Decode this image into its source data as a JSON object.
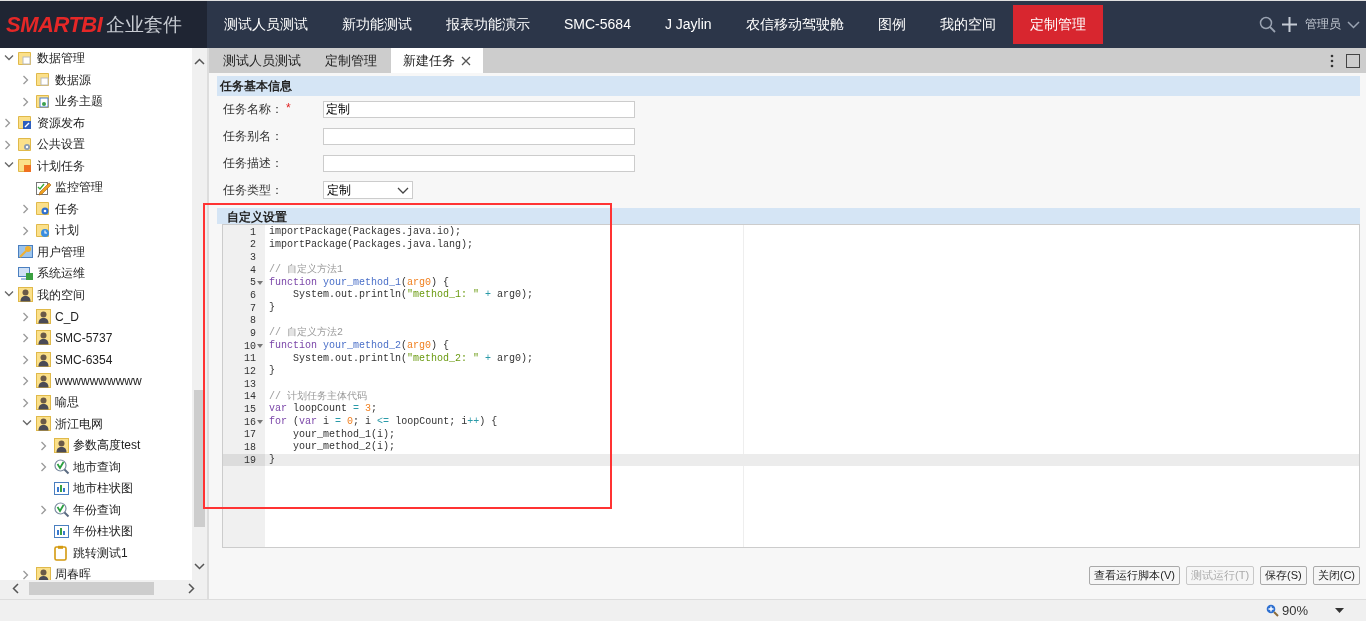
{
  "header": {
    "logo_brand": "SMARTBI",
    "logo_suffix": "企业套件",
    "nav": [
      {
        "label": "测试人员测试",
        "selected": false
      },
      {
        "label": "新功能测试",
        "selected": false
      },
      {
        "label": "报表功能演示",
        "selected": false
      },
      {
        "label": "SMC-5684",
        "selected": false
      },
      {
        "label": "J Jaylin",
        "selected": false
      },
      {
        "label": "农信移动驾驶舱",
        "selected": false
      },
      {
        "label": "图例",
        "selected": false
      },
      {
        "label": "我的空间",
        "selected": false
      },
      {
        "label": "定制管理",
        "selected": true
      }
    ],
    "user": "管理员"
  },
  "sidebar": {
    "items": [
      {
        "label": "数据管理",
        "kind": "folder",
        "expanded": true,
        "children": [
          {
            "label": "数据源",
            "kind": "folder",
            "expanded": false
          },
          {
            "label": "业务主题",
            "kind": "topic",
            "expanded": false
          }
        ]
      },
      {
        "label": "资源发布",
        "kind": "publish",
        "expanded": false
      },
      {
        "label": "公共设置",
        "kind": "settings",
        "expanded": false
      },
      {
        "label": "计划任务",
        "kind": "schedule",
        "expanded": true,
        "children": [
          {
            "label": "监控管理",
            "kind": "pencil"
          },
          {
            "label": "任务",
            "kind": "task",
            "expanded": false
          },
          {
            "label": "计划",
            "kind": "clock",
            "expanded": false
          }
        ]
      },
      {
        "label": "用户管理",
        "kind": "users"
      },
      {
        "label": "系统运维",
        "kind": "monitor"
      },
      {
        "label": "我的空间",
        "kind": "user",
        "expanded": true,
        "children": [
          {
            "label": "C_D",
            "kind": "user",
            "expanded": false
          },
          {
            "label": "SMC-5737",
            "kind": "user",
            "expanded": false
          },
          {
            "label": "SMC-6354",
            "kind": "user",
            "expanded": false
          },
          {
            "label": "wwwwwwwwww",
            "kind": "user",
            "expanded": false
          },
          {
            "label": "喻思",
            "kind": "user",
            "expanded": false
          },
          {
            "label": "浙江电网",
            "kind": "user",
            "expanded": true,
            "children": [
              {
                "label": "参数高度test",
                "kind": "user",
                "expanded": false
              },
              {
                "label": "地市查询",
                "kind": "query",
                "expanded": false
              },
              {
                "label": "地市柱状图",
                "kind": "chart"
              },
              {
                "label": "年份查询",
                "kind": "query",
                "expanded": false
              },
              {
                "label": "年份柱状图",
                "kind": "chart"
              },
              {
                "label": "跳转测试1",
                "kind": "clipboard"
              }
            ]
          },
          {
            "label": "周春晖",
            "kind": "user",
            "expanded": false
          }
        ]
      }
    ]
  },
  "tabs": [
    {
      "label": "测试人员测试",
      "selected": false,
      "closable": false
    },
    {
      "label": "定制管理",
      "selected": false,
      "closable": false
    },
    {
      "label": "新建任务",
      "selected": true,
      "closable": true
    }
  ],
  "basic_info": {
    "title": "任务基本信息",
    "fields": [
      {
        "label": "任务名称：",
        "marker": "*",
        "kind": "text",
        "value": "定制"
      },
      {
        "label": "任务别名：",
        "kind": "text"
      },
      {
        "label": "任务描述：",
        "kind": "text"
      },
      {
        "label": "任务类型：",
        "kind": "select",
        "value": "定制"
      }
    ]
  },
  "custom_settings": {
    "title": "自定义设置",
    "editor": {
      "lines": [
        {
          "number": "1",
          "fold": false,
          "active": false,
          "tokens": [
            {
              "kind": "plain",
              "text": "importPackage(Packages.java.io);"
            }
          ]
        },
        {
          "number": "2",
          "fold": false,
          "active": false,
          "tokens": [
            {
              "kind": "plain",
              "text": "importPackage(Packages.java.lang);"
            }
          ]
        },
        {
          "number": "3",
          "fold": false,
          "active": false
        },
        {
          "number": "4",
          "fold": false,
          "active": false,
          "tokens": [
            {
              "kind": "comment",
              "text": "// 自定义方法1"
            }
          ]
        },
        {
          "number": "5",
          "fold": true,
          "active": false,
          "tokens": [
            {
              "kind": "keyword",
              "text": "function"
            },
            {
              "kind": "name",
              "text": " your_method_1"
            },
            {
              "kind": "plain",
              "text": "("
            },
            {
              "kind": "param",
              "text": "arg0"
            },
            {
              "kind": "plain",
              "text": ") {"
            }
          ]
        },
        {
          "number": "6",
          "fold": false,
          "active": false,
          "tokens": [
            {
              "kind": "plain",
              "text": "    System.out.println("
            },
            {
              "kind": "string",
              "text": "\"method_1: \""
            },
            {
              "kind": "op",
              "text": " +"
            },
            {
              "kind": "plain",
              "text": " arg0);"
            }
          ]
        },
        {
          "number": "7",
          "fold": false,
          "active": false,
          "tokens": [
            {
              "kind": "plain",
              "text": "}"
            }
          ]
        },
        {
          "number": "8",
          "fold": false,
          "active": false
        },
        {
          "number": "9",
          "fold": false,
          "active": false,
          "tokens": [
            {
              "kind": "comment",
              "text": "// 自定义方法2"
            }
          ]
        },
        {
          "number": "10",
          "fold": true,
          "active": false,
          "tokens": [
            {
              "kind": "keyword",
              "text": "function"
            },
            {
              "kind": "name",
              "text": " your_method_2"
            },
            {
              "kind": "plain",
              "text": "("
            },
            {
              "kind": "param",
              "text": "arg0"
            },
            {
              "kind": "plain",
              "text": ") {"
            }
          ]
        },
        {
          "number": "11",
          "fold": false,
          "active": false,
          "tokens": [
            {
              "kind": "plain",
              "text": "    System.out.println("
            },
            {
              "kind": "string",
              "text": "\"method_2: \""
            },
            {
              "kind": "op",
              "text": " +"
            },
            {
              "kind": "plain",
              "text": " arg0);"
            }
          ]
        },
        {
          "number": "12",
          "fold": false,
          "active": false,
          "tokens": [
            {
              "kind": "plain",
              "text": "}"
            }
          ]
        },
        {
          "number": "13",
          "fold": false,
          "active": false
        },
        {
          "number": "14",
          "fold": false,
          "active": false,
          "tokens": [
            {
              "kind": "comment",
              "text": "// 计划任务主体代码"
            }
          ]
        },
        {
          "number": "15",
          "fold": false,
          "active": false,
          "tokens": [
            {
              "kind": "keyword",
              "text": "var"
            },
            {
              "kind": "plain",
              "text": " loopCount "
            },
            {
              "kind": "op",
              "text": "="
            },
            {
              "kind": "number",
              "text": " 3"
            },
            {
              "kind": "plain",
              "text": ";"
            }
          ]
        },
        {
          "number": "16",
          "fold": true,
          "active": false,
          "tokens": [
            {
              "kind": "keyword",
              "text": "for"
            },
            {
              "kind": "plain",
              "text": " ("
            },
            {
              "kind": "keyword",
              "text": "var"
            },
            {
              "kind": "plain",
              "text": " i "
            },
            {
              "kind": "op",
              "text": "="
            },
            {
              "kind": "number",
              "text": " 0"
            },
            {
              "kind": "plain",
              "text": "; i "
            },
            {
              "kind": "op",
              "text": "<="
            },
            {
              "kind": "plain",
              "text": " loopCount; i"
            },
            {
              "kind": "op",
              "text": "++"
            },
            {
              "kind": "plain",
              "text": ") {"
            }
          ]
        },
        {
          "number": "17",
          "fold": false,
          "active": false,
          "tokens": [
            {
              "kind": "plain",
              "text": "    your_method_1(i);"
            }
          ]
        },
        {
          "number": "18",
          "fold": false,
          "active": false,
          "tokens": [
            {
              "kind": "plain",
              "text": "    your_method_2(i);"
            }
          ]
        },
        {
          "number": "19",
          "fold": false,
          "active": true,
          "tokens": [
            {
              "kind": "plain",
              "text": "}"
            }
          ]
        }
      ]
    }
  },
  "buttons": [
    {
      "label": "查看运行脚本(V)",
      "disabled": false
    },
    {
      "label": "测试运行(T)",
      "disabled": true
    },
    {
      "label": "保存(S)",
      "disabled": false
    },
    {
      "label": "关闭(C)",
      "disabled": false
    }
  ],
  "status_bar": {
    "zoom": "90%"
  }
}
